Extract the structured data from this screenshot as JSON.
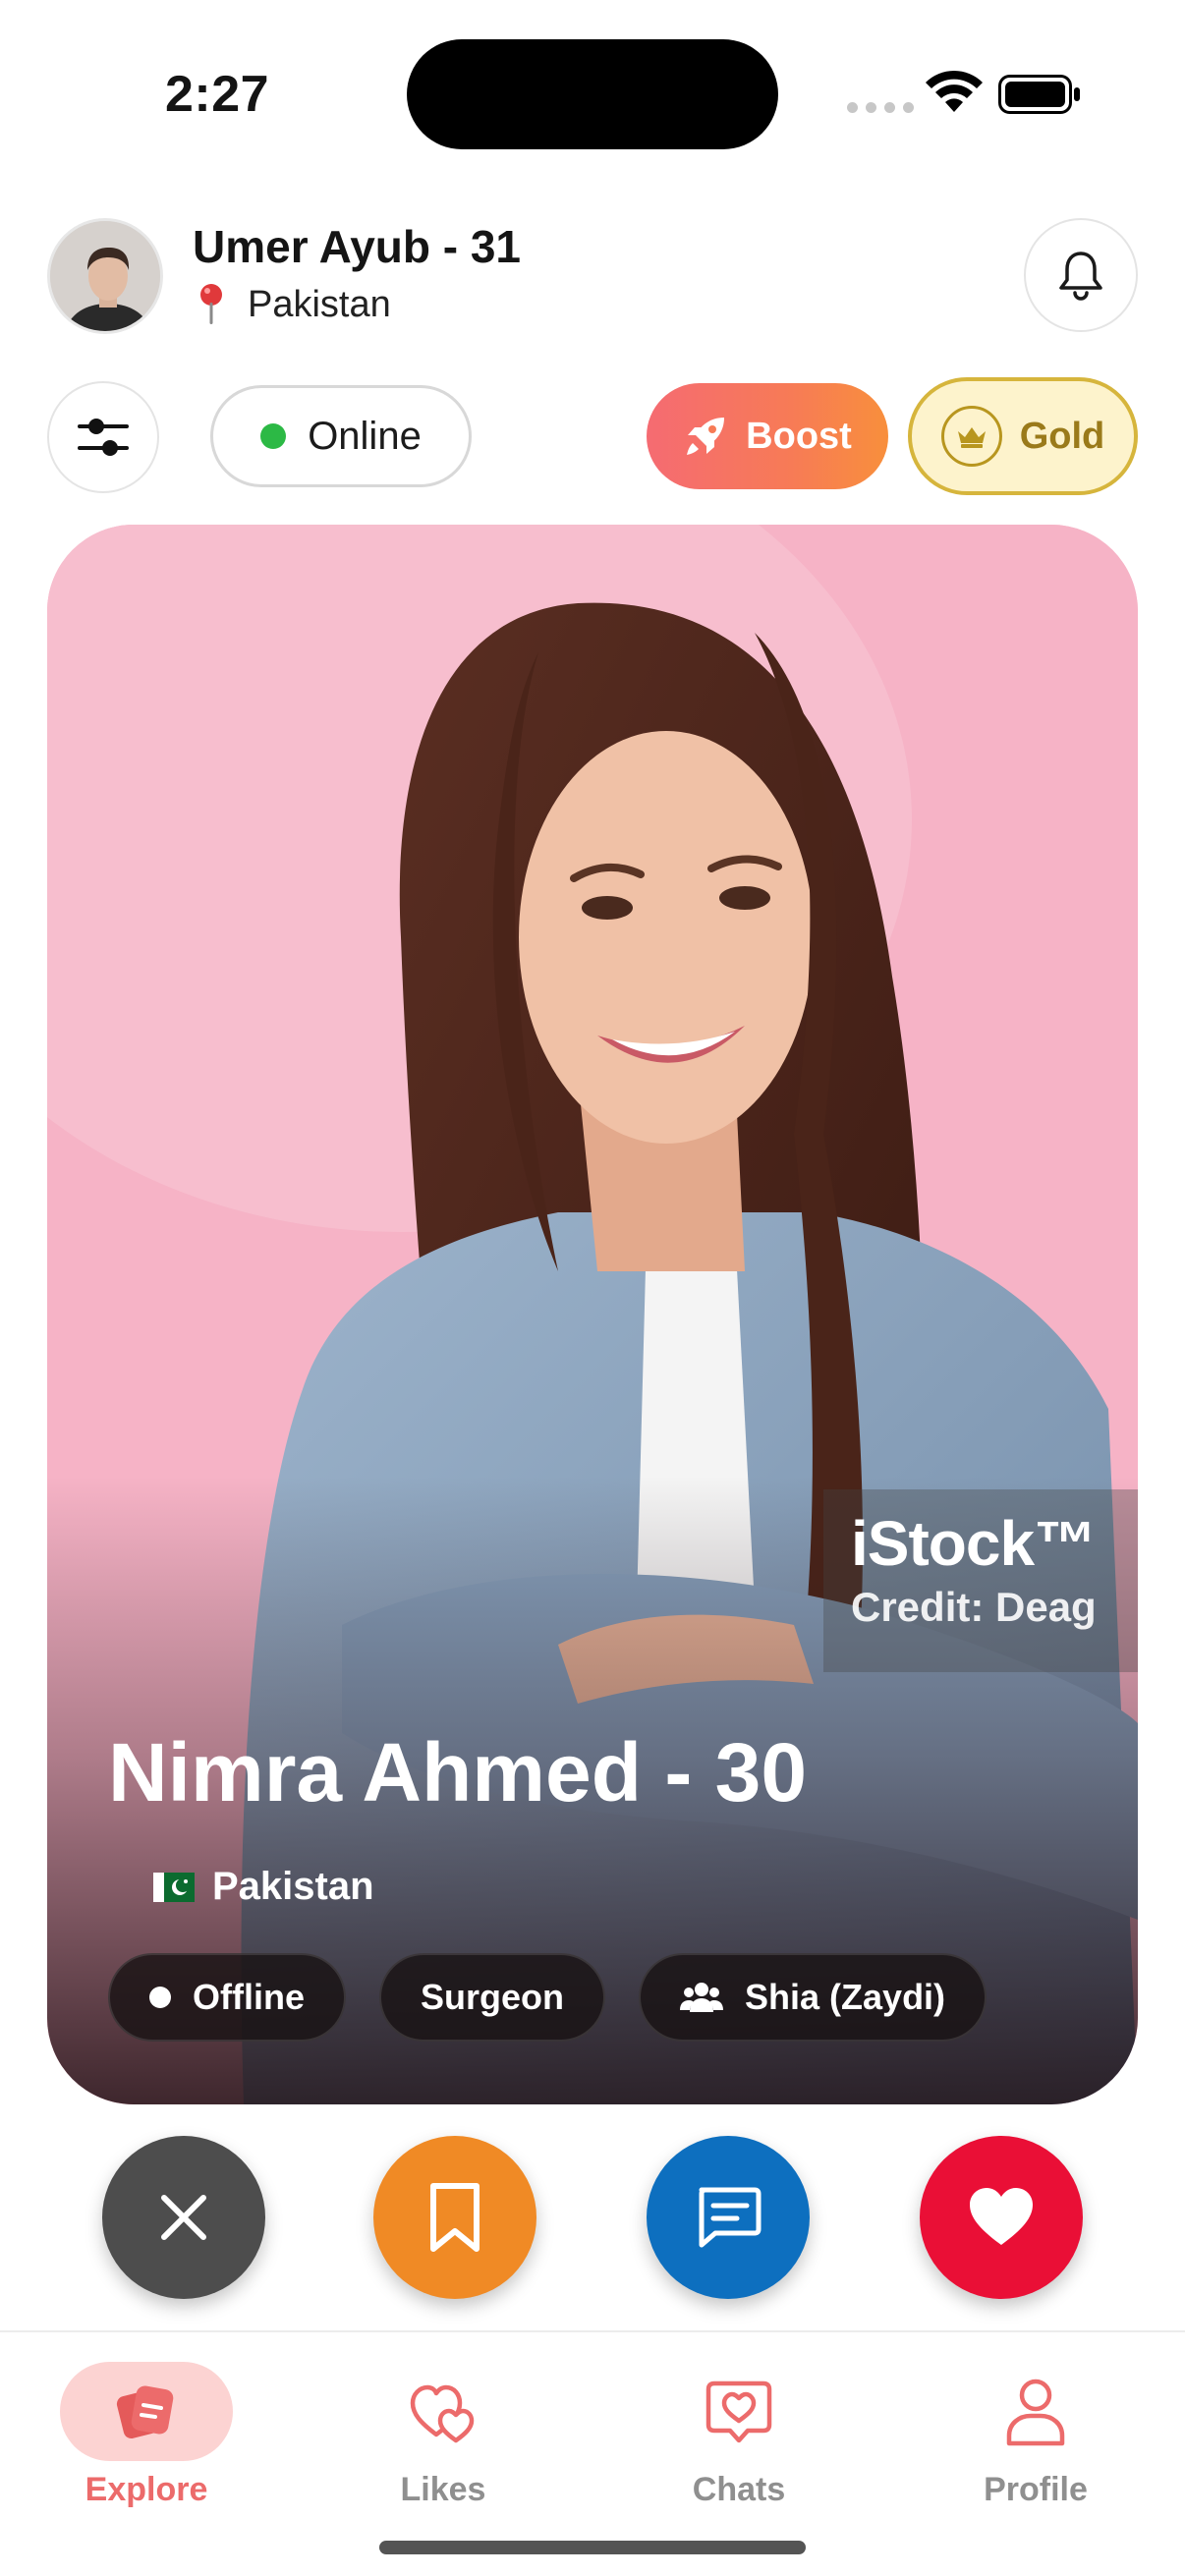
{
  "status_bar": {
    "time": "2:27"
  },
  "header": {
    "user_name": "Umer Ayub - 31",
    "user_location": "Pakistan",
    "icons": {
      "avatar": "user-avatar",
      "location": "pin-icon",
      "notifications": "bell-icon"
    }
  },
  "toolbar": {
    "filter_icon": "sliders-icon",
    "status_label": "Online",
    "boost_label": "Boost",
    "gold_label": "Gold"
  },
  "profile_card": {
    "name": "Nimra Ahmed - 30",
    "location": "Pakistan",
    "watermark": {
      "brand": "iStock™",
      "credit": "Credit: Deag"
    },
    "tags": [
      {
        "label": "Offline",
        "icon": "dot-icon"
      },
      {
        "label": "Surgeon"
      },
      {
        "label": "Shia (Zaydi)",
        "icon": "group-icon"
      }
    ]
  },
  "actions": {
    "pass": "close-icon",
    "save": "bookmark-icon",
    "message": "message-icon",
    "like": "heart-icon"
  },
  "bottom_nav": [
    {
      "label": "Explore",
      "icon": "cards-icon",
      "active": true
    },
    {
      "label": "Likes",
      "icon": "hearts-icon",
      "active": false
    },
    {
      "label": "Chats",
      "icon": "heart-chat-icon",
      "active": false
    },
    {
      "label": "Profile",
      "icon": "person-icon",
      "active": false
    }
  ],
  "colors": {
    "accent": "#EC6B6B",
    "online": "#2CB945",
    "gold": "#D6B53C",
    "pass": "#4D4D4D",
    "save": "#F08A25",
    "message": "#0D6FBF",
    "like": "#EA0F36"
  }
}
